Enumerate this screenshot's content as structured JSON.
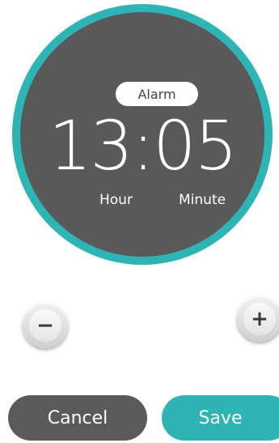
{
  "clock": {
    "mode_label": "Alarm",
    "time": "13:05",
    "hour_label": "Hour",
    "minute_label": "Minute"
  },
  "controls": {
    "decrement_symbol": "−",
    "increment_symbol": "+"
  },
  "actions": {
    "cancel_label": "Cancel",
    "save_label": "Save"
  },
  "colors": {
    "accent": "#2eb4b4",
    "dial_face": "#595959",
    "cancel_button": "#5a5a5a"
  }
}
